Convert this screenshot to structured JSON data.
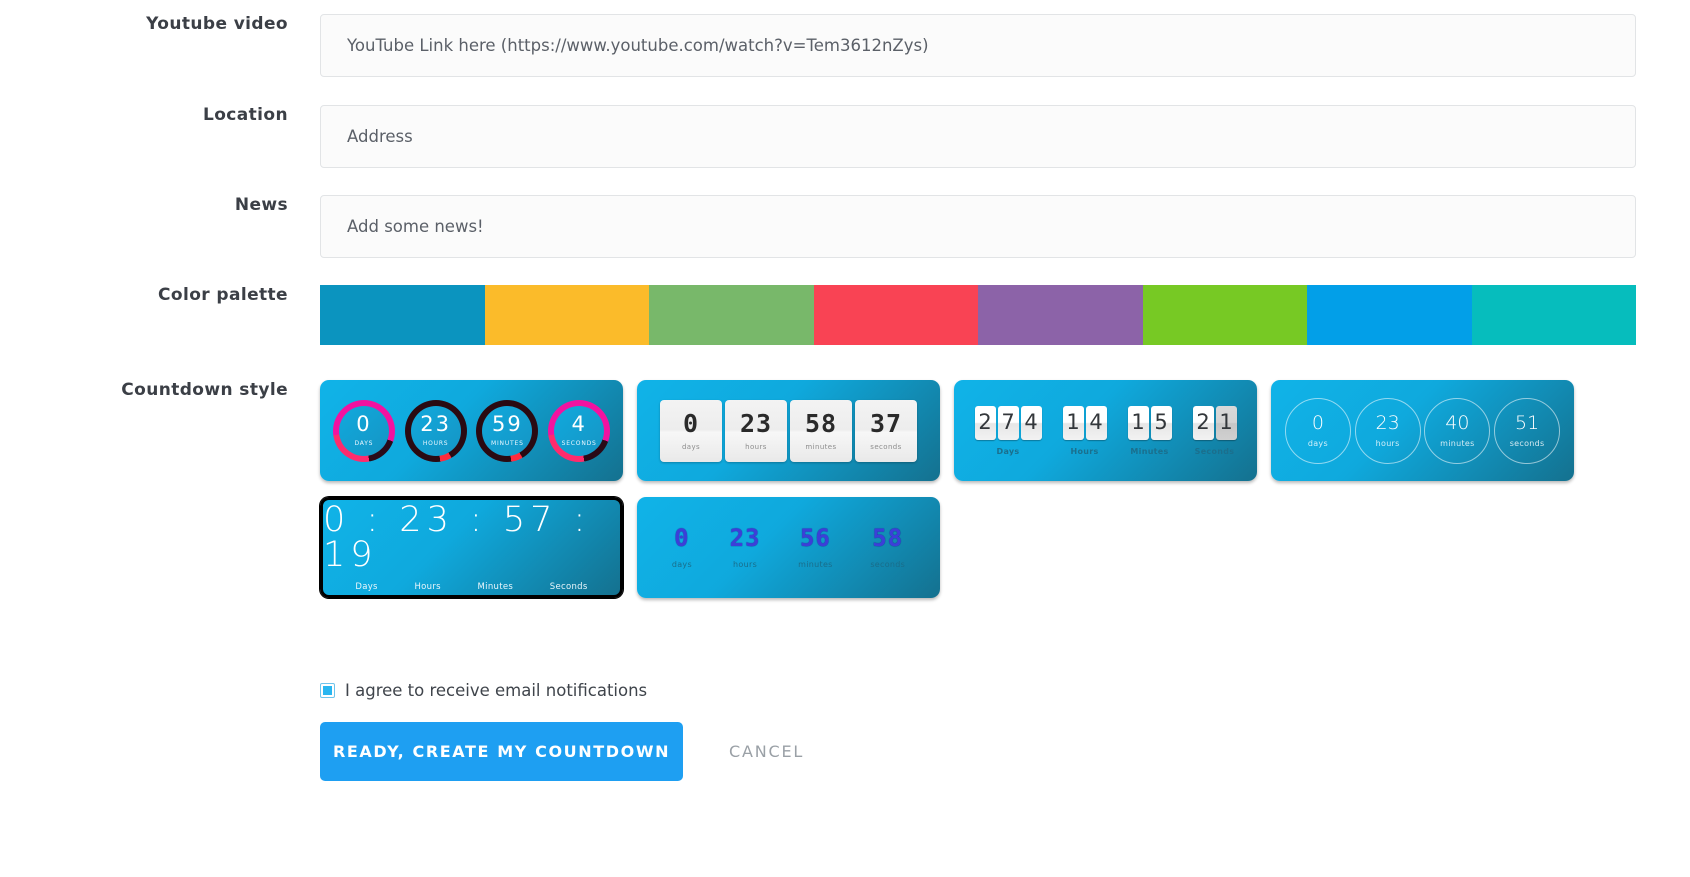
{
  "form": {
    "rows": [
      {
        "label": "Youtube video",
        "placeholder": "YouTube Link here (https://www.youtube.com/watch?v=Tem3612nZys)",
        "value": ""
      },
      {
        "label": "Location",
        "placeholder": "Address",
        "value": ""
      },
      {
        "label": "News",
        "placeholder": "Add some news!",
        "value": ""
      }
    ],
    "palette_label": "Color palette",
    "style_label": "Countdown style"
  },
  "palette": {
    "colors": [
      "#0b94bf",
      "#fbbb2a",
      "#78b86a",
      "#f94354",
      "#8c63a8",
      "#77c924",
      "#029fe8",
      "#06bdbd"
    ]
  },
  "styles": [
    {
      "id": "rings",
      "selected": false,
      "units": [
        {
          "value": "0",
          "label": "DAYS"
        },
        {
          "value": "23",
          "label": "HOURS"
        },
        {
          "value": "59",
          "label": "MINUTES"
        },
        {
          "value": "4",
          "label": "SECONDS"
        }
      ]
    },
    {
      "id": "flip",
      "selected": false,
      "units": [
        {
          "value": "0",
          "label": "days"
        },
        {
          "value": "23",
          "label": "hours"
        },
        {
          "value": "58",
          "label": "minutes"
        },
        {
          "value": "37",
          "label": "seconds"
        }
      ]
    },
    {
      "id": "tiles",
      "selected": false,
      "units": [
        {
          "digits": [
            "2",
            "7",
            "4"
          ],
          "label": "Days"
        },
        {
          "digits": [
            "1",
            "4"
          ],
          "label": "Hours"
        },
        {
          "digits": [
            "1",
            "5"
          ],
          "label": "Minutes"
        },
        {
          "digits": [
            "2",
            "1"
          ],
          "label": "Seconds"
        }
      ]
    },
    {
      "id": "thin-circles",
      "selected": false,
      "units": [
        {
          "value": "0",
          "label": "days"
        },
        {
          "value": "23",
          "label": "hours"
        },
        {
          "value": "40",
          "label": "minutes"
        },
        {
          "value": "51",
          "label": "seconds"
        }
      ]
    },
    {
      "id": "digital",
      "selected": true,
      "display": "0 : 23 : 57 : 19",
      "units": [
        {
          "label": "Days"
        },
        {
          "label": "Hours"
        },
        {
          "label": "Minutes"
        },
        {
          "label": "Seconds"
        }
      ]
    },
    {
      "id": "led",
      "selected": false,
      "units": [
        {
          "value": "0",
          "label": "days"
        },
        {
          "value": "23",
          "label": "hours"
        },
        {
          "value": "56",
          "label": "minutes"
        },
        {
          "value": "58",
          "label": "seconds"
        }
      ]
    }
  ],
  "footer": {
    "agree_label": "I agree to receive email notifications",
    "agree_checked": true,
    "submit_label": "READY, CREATE MY COUNTDOWN",
    "cancel_label": "CANCEL",
    "accent_color": "#1e9ff2"
  }
}
